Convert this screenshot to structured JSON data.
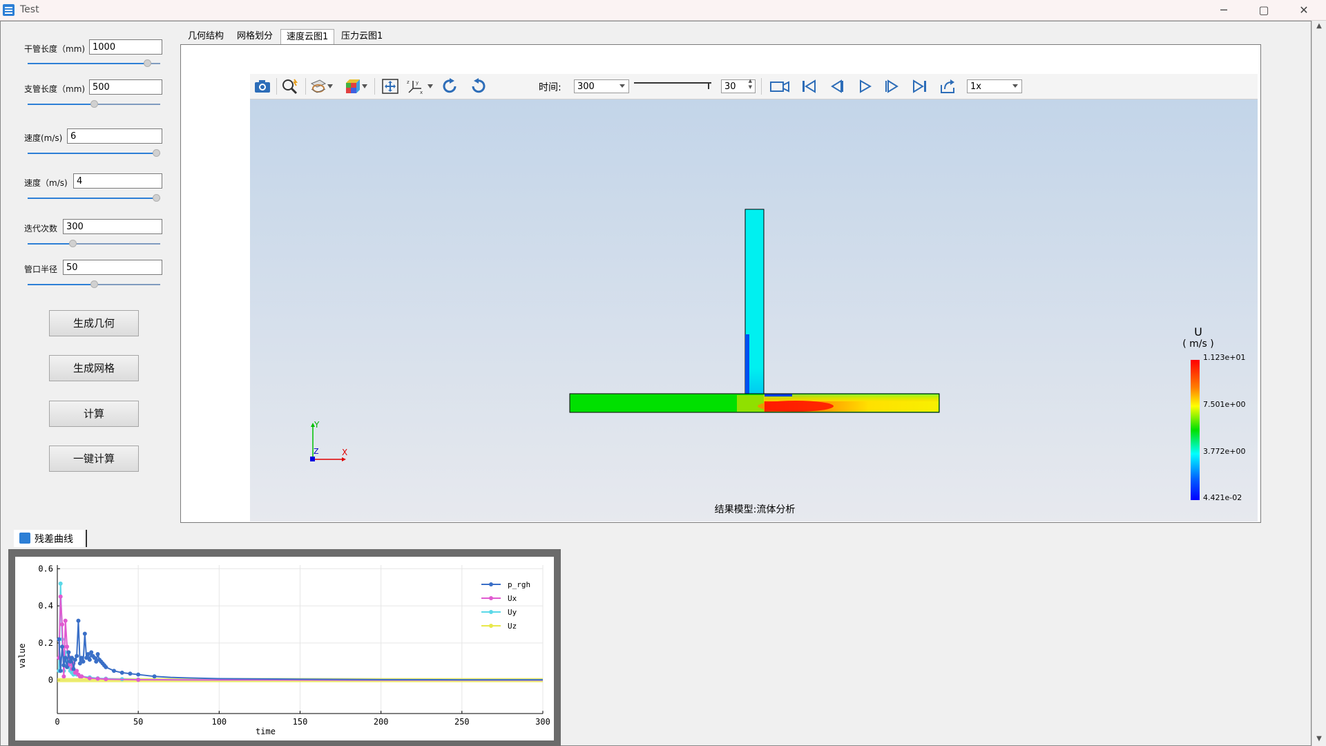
{
  "window": {
    "title": "Test",
    "buttons": [
      "─",
      "▢",
      "✕"
    ]
  },
  "params": [
    {
      "label": "干管长度（mm)",
      "value": "1000",
      "fraction": 0.93
    },
    {
      "label": "支管长度（mm)",
      "value": "500",
      "fraction": 0.5
    },
    {
      "label": "速度(m/s)",
      "value": "6",
      "fraction": 1.0
    },
    {
      "label": "速度（m/s)",
      "value": "4",
      "fraction": 1.0
    },
    {
      "label": "迭代次数",
      "value": "300",
      "fraction": 0.33
    },
    {
      "label": "管口半径",
      "value": "50",
      "fraction": 0.5
    }
  ],
  "buttons": {
    "geometry": "生成几何",
    "mesh": "生成网格",
    "compute": "计算",
    "one_click": "一键计算"
  },
  "tabs": [
    "几何结构",
    "网格划分",
    "速度云图1",
    "压力云图1"
  ],
  "active_tab": 2,
  "toolbar": {
    "time_label": "时间:",
    "time_value": "300",
    "frame_value": "30",
    "speed_value": "1x",
    "icons": [
      "camera-icon",
      "zoom-icon",
      "clip-plane-icon",
      "color-cube-icon",
      "fit-view-icon",
      "axes-icon",
      "rotate-cw-icon",
      "rotate-ccw-icon",
      "record-icon",
      "first-frame-icon",
      "prev-frame-icon",
      "play-icon",
      "next-frame-icon",
      "last-frame-icon",
      "export-icon"
    ]
  },
  "viewport": {
    "model_caption": "结果模型:流体分析",
    "colorbar": {
      "title": "U",
      "unit": "( m/s )",
      "ticks": [
        "1.123e+01",
        "7.501e+00",
        "3.772e+00",
        "4.421e-02"
      ]
    },
    "axes": {
      "x": "X",
      "y": "Y",
      "z": "Z"
    }
  },
  "residual": {
    "tab_label": "残差曲线",
    "icon": "app-icon"
  },
  "chart_data": {
    "type": "line",
    "xlabel": "time",
    "ylabel": "value",
    "xlim": [
      0,
      300
    ],
    "ylim": [
      -0.18,
      0.62
    ],
    "x_ticks": [
      0,
      50,
      100,
      150,
      200,
      250,
      300
    ],
    "y_ticks": [
      0,
      0.2,
      0.4,
      0.6
    ],
    "y_tick_labels": [
      "0",
      "0.2",
      "0.4",
      "0.6"
    ],
    "legend_position": "top-right",
    "grid": true,
    "series": [
      {
        "name": "p_rgh",
        "color": "#3a6fc7",
        "x": [
          1,
          2,
          3,
          4,
          5,
          6,
          7,
          8,
          9,
          10,
          11,
          12,
          13,
          14,
          15,
          16,
          17,
          18,
          19,
          20,
          21,
          22,
          23,
          24,
          25,
          26,
          27,
          28,
          29,
          30,
          35,
          40,
          45,
          50,
          60,
          70,
          80,
          100,
          150,
          200,
          250,
          300
        ],
        "y": [
          0.22,
          0.05,
          0.18,
          0.08,
          0.12,
          0.07,
          0.15,
          0.1,
          0.12,
          0.06,
          0.11,
          0.13,
          0.32,
          0.09,
          0.12,
          0.1,
          0.25,
          0.12,
          0.14,
          0.11,
          0.15,
          0.13,
          0.12,
          0.1,
          0.14,
          0.11,
          0.1,
          0.09,
          0.08,
          0.07,
          0.05,
          0.04,
          0.035,
          0.03,
          0.02,
          0.015,
          0.012,
          0.008,
          0.005,
          0.003,
          0.002,
          0.002
        ]
      },
      {
        "name": "Ux",
        "color": "#e05ad0",
        "x": [
          1,
          2,
          3,
          4,
          5,
          6,
          7,
          8,
          9,
          10,
          11,
          12,
          13,
          14,
          15,
          20,
          25,
          30,
          50,
          100,
          200,
          300
        ],
        "y": [
          0.12,
          0.45,
          0.3,
          0.02,
          0.32,
          0.18,
          0.08,
          0.12,
          0.06,
          0.09,
          0.04,
          0.05,
          0.03,
          0.02,
          0.02,
          0.01,
          0.008,
          0.005,
          0.002,
          0.001,
          0.0,
          0.0
        ]
      },
      {
        "name": "Uy",
        "color": "#5ad8e8",
        "x": [
          1,
          2,
          3,
          4,
          5,
          6,
          7,
          8,
          9,
          10,
          12,
          15,
          20,
          25,
          30,
          40,
          50,
          100,
          200,
          300
        ],
        "y": [
          0.05,
          0.52,
          0.22,
          0.05,
          0.15,
          0.1,
          0.07,
          0.05,
          0.04,
          0.03,
          0.03,
          0.02,
          0.015,
          0.01,
          0.008,
          0.005,
          0.003,
          0.001,
          0.0,
          0.0
        ]
      },
      {
        "name": "Uz",
        "color": "#e8e84a",
        "x": [
          0,
          50,
          100,
          150,
          200,
          250,
          300
        ],
        "y": [
          0,
          0,
          0,
          0,
          0,
          0,
          0
        ]
      }
    ]
  }
}
